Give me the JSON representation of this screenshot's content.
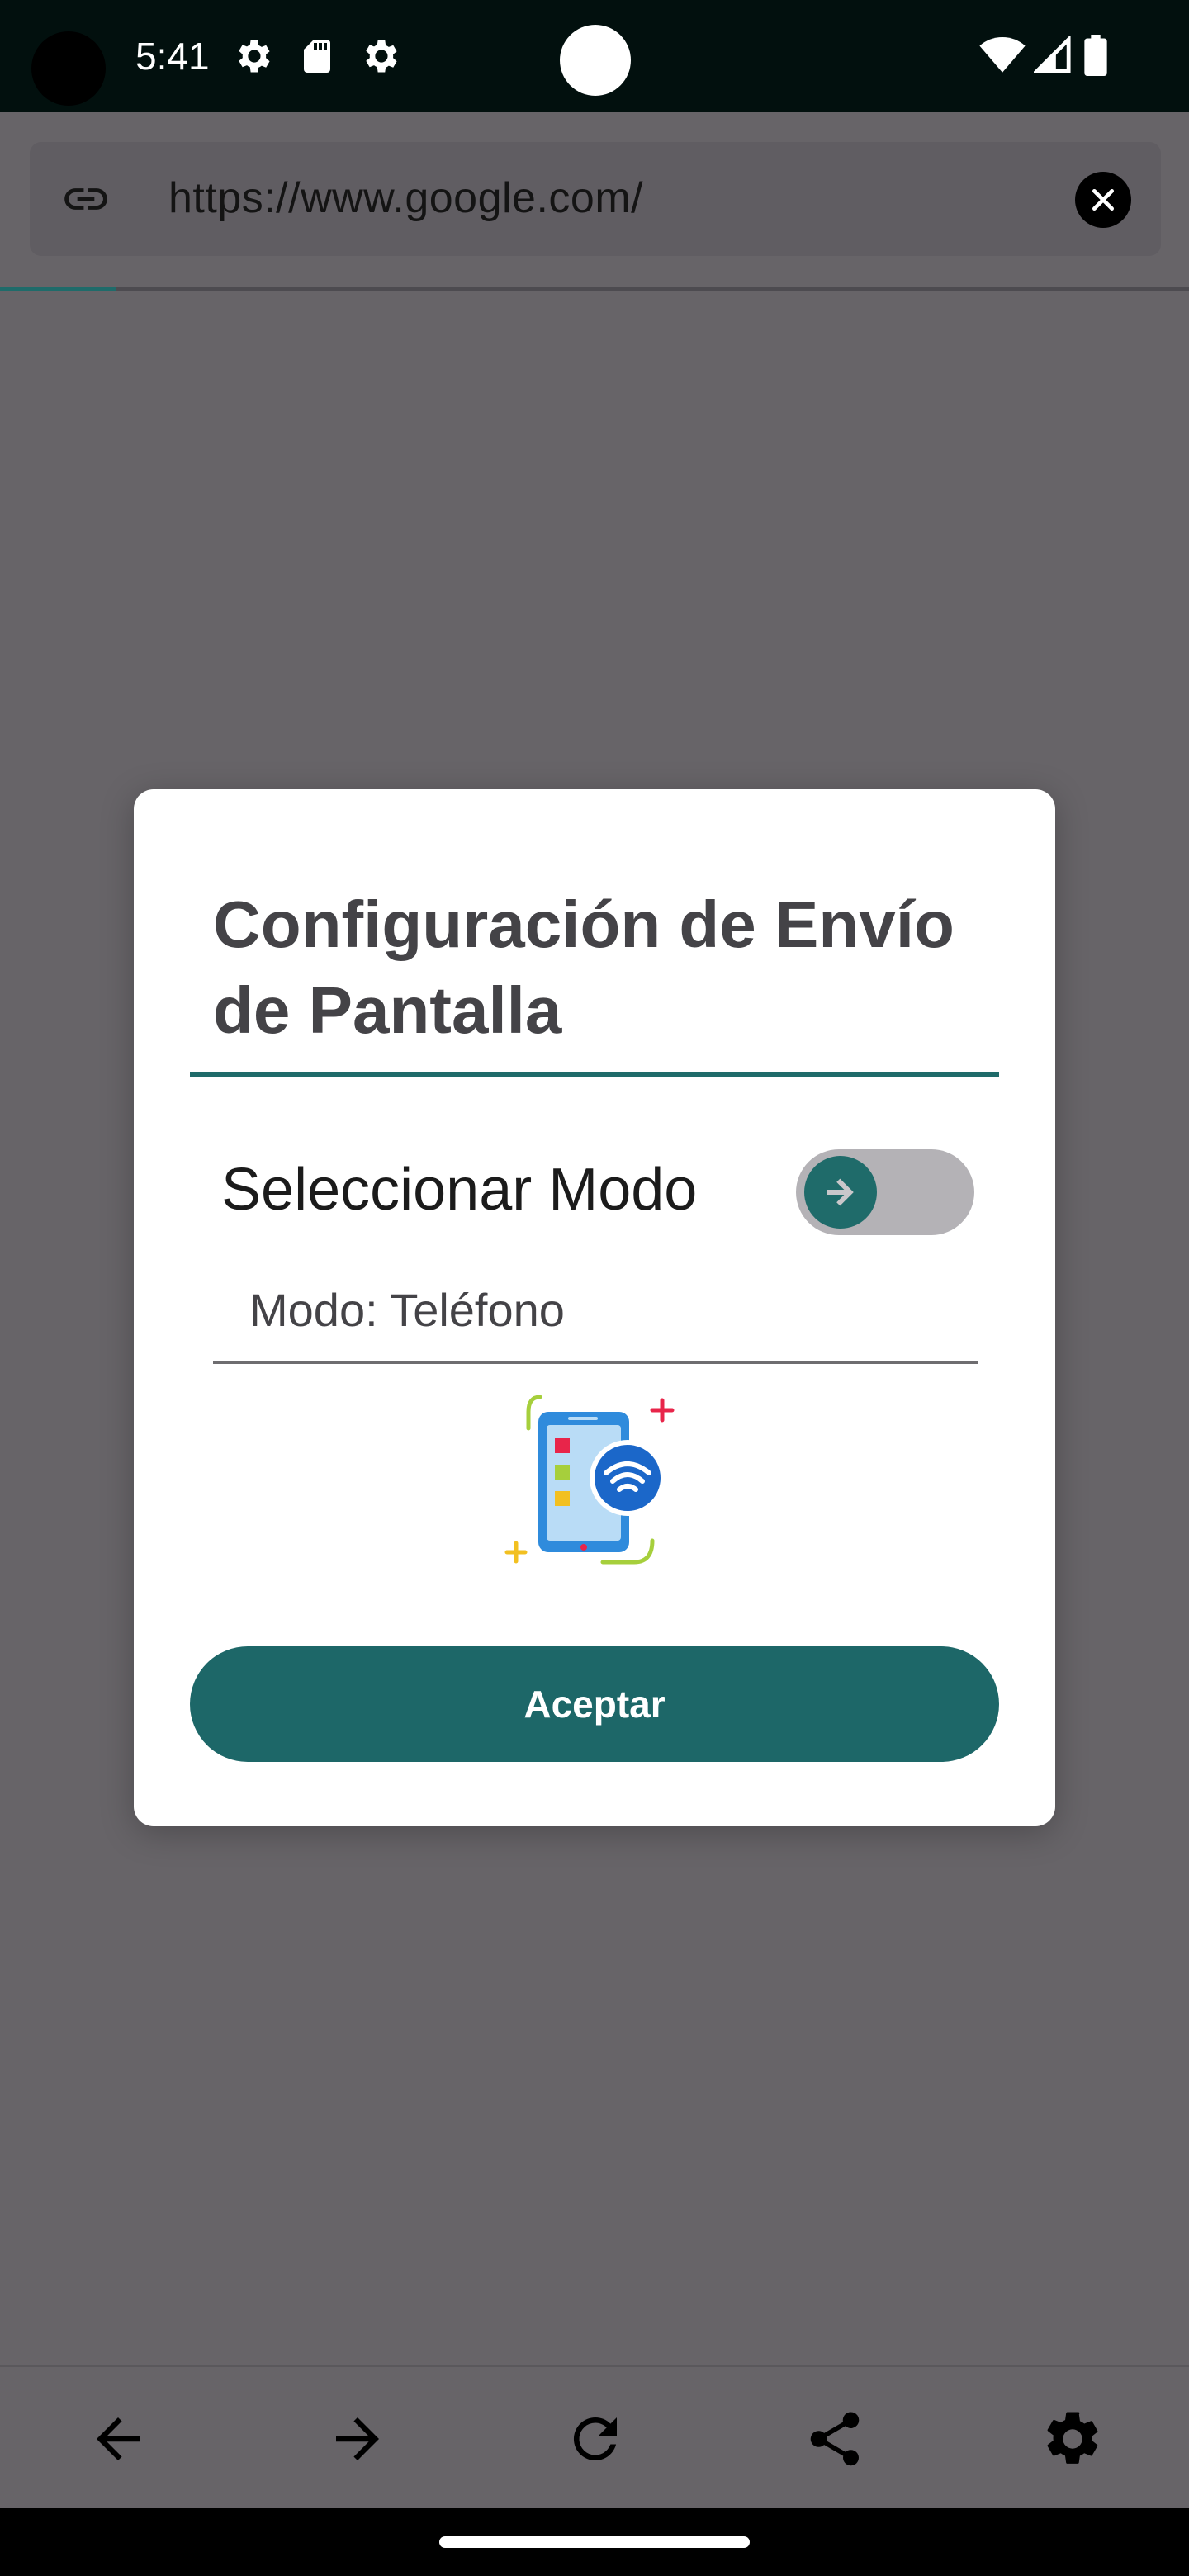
{
  "status_bar": {
    "time": "5:41",
    "icons": [
      "settings-gear-icon",
      "sd-card-icon",
      "settings-gear-icon",
      "wifi-icon",
      "signal-icon",
      "battery-icon"
    ]
  },
  "url_bar": {
    "url": "https://www.google.com/",
    "icons": [
      "link-icon",
      "clear-icon"
    ]
  },
  "dialog": {
    "title": "Configuración de Envío de Pantalla",
    "mode_label": "Seleccionar Modo",
    "mode_value": "Modo: Teléfono",
    "accept_label": "Aceptar",
    "toggle_on": false
  },
  "bottom_nav": {
    "items": [
      "back-arrow-icon",
      "forward-arrow-icon",
      "refresh-icon",
      "share-icon",
      "settings-icon"
    ]
  },
  "colors": {
    "accent": "#1d6768",
    "scrim": "#676468",
    "status_bar": "#02100e"
  }
}
